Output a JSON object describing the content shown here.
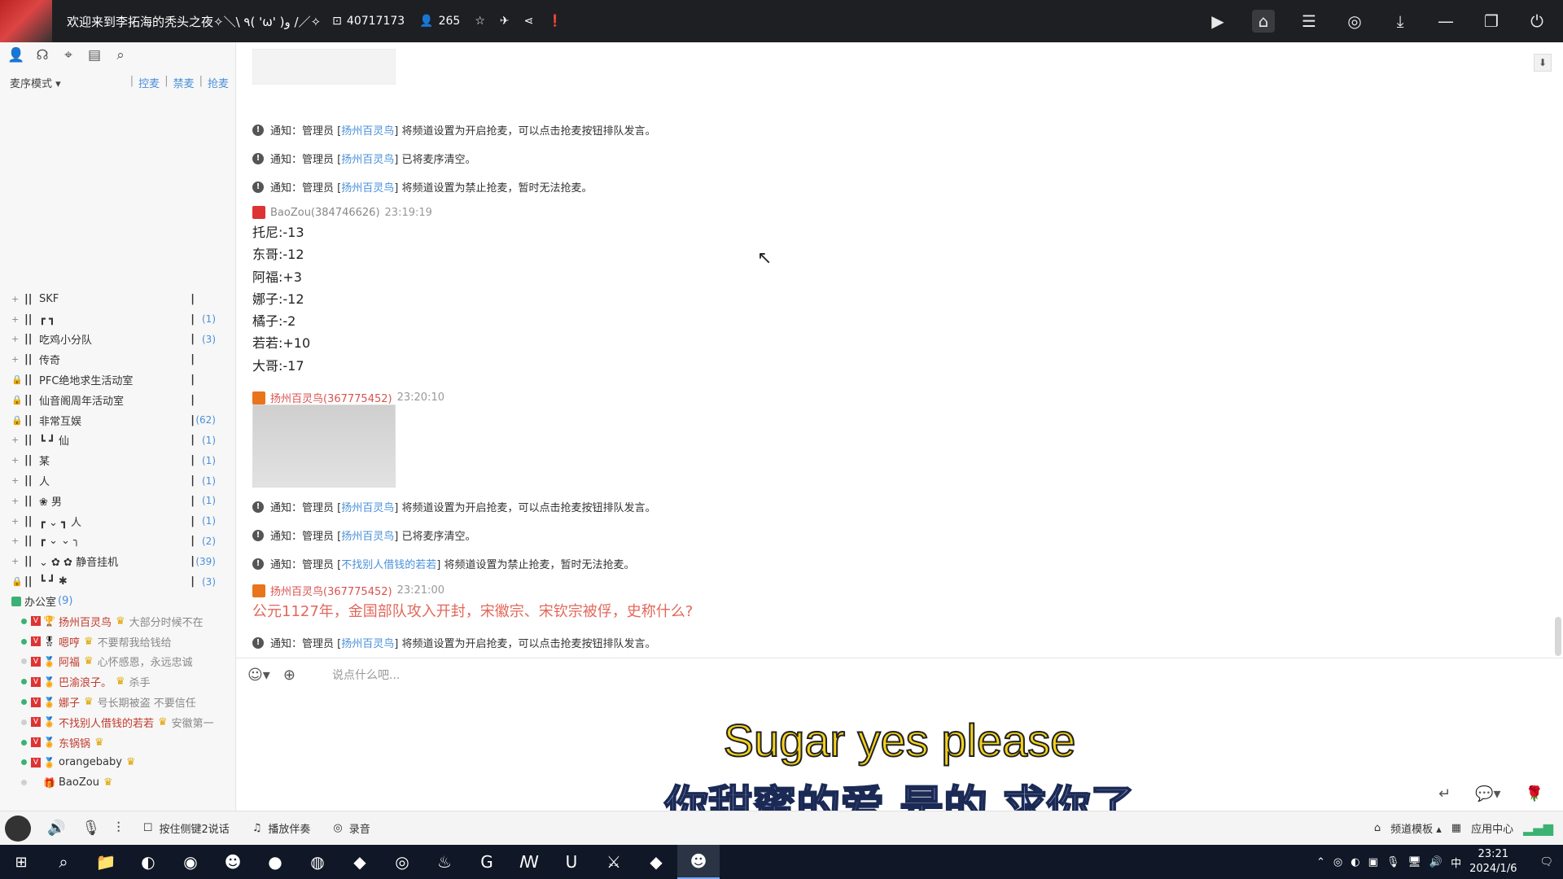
{
  "topbar": {
    "title": "欢迎来到李拓海的秃头之夜✧＼\\ ٩( 'ω' )و /／✧",
    "channel_id": "40717173",
    "online_count": "265",
    "icons": [
      "star-icon",
      "forward-icon",
      "share-icon",
      "info-icon"
    ],
    "right_icons": [
      "video-icon",
      "home-icon",
      "list-icon",
      "gamepad-icon",
      "download-icon",
      "minimize-icon",
      "restore-icon",
      "power-icon"
    ]
  },
  "left": {
    "toolbar_icons": [
      "user-icon",
      "headset-icon",
      "location-icon",
      "document-icon",
      "search-icon"
    ],
    "mic_mode": "麦序模式",
    "mic_links": [
      "控麦",
      "禁麦",
      "抢麦"
    ],
    "channels": [
      {
        "name": "SKF",
        "count": ""
      },
      {
        "name": "┏      ┓",
        "count": "(1)"
      },
      {
        "name": "吃鸡小分队",
        "count": "(3)"
      },
      {
        "name": "传奇",
        "count": ""
      },
      {
        "name": "PFC绝地求生活动室",
        "count": ""
      },
      {
        "name": "仙音阁周年活动室",
        "count": ""
      },
      {
        "name": "非常互娱",
        "count": "(62)"
      },
      {
        "name": "┗      ┛      仙",
        "count": "(1)"
      },
      {
        "name": "                  某",
        "count": "(1)"
      },
      {
        "name": "                  人",
        "count": "(1)"
      },
      {
        "name": "        ❀         男",
        "count": "(1)"
      },
      {
        "name": "   ┏ ⌄ ┓        人",
        "count": "(1)"
      },
      {
        "name": "┏ ⌄   ⌄ ╮",
        "count": "(2)"
      },
      {
        "name": "⌄ ✿  ✿  静音挂机",
        "count": "(39)"
      },
      {
        "name": "  ┗ ┛   ✱",
        "count": "(3)"
      }
    ],
    "office": {
      "name": "办公室",
      "count": "(9)"
    },
    "members": [
      {
        "name": "扬州百灵鸟",
        "sig": "大部分时候不在",
        "online": true
      },
      {
        "name": "嗯哼",
        "sig": "不要帮我给钱给",
        "online": true
      },
      {
        "name": "阿福",
        "sig": "心怀感恩，永远忠诚",
        "online": false
      },
      {
        "name": "巴渝浪子。",
        "sig": "杀手",
        "online": true
      },
      {
        "name": "娜子",
        "sig": "号长期被盗 不要信任",
        "online": true
      },
      {
        "name": "不找别人借钱的若若",
        "sig": "安徽第一",
        "online": false
      },
      {
        "name": "东锅锅",
        "sig": "",
        "online": true
      },
      {
        "name": "orangebaby",
        "sig": "",
        "online": true
      },
      {
        "name": "BaoZou",
        "sig": "",
        "online": false
      }
    ]
  },
  "chat": {
    "notices_top": [
      {
        "prefix": "通知：管理员 [",
        "who": "扬州百灵鸟",
        "text": "] 将频道设置为开启抢麦，可以点击抢麦按钮排队发言。"
      },
      {
        "prefix": "通知：管理员 [",
        "who": "扬州百灵鸟",
        "text": "] 已将麦序清空。"
      },
      {
        "prefix": "通知：管理员 [",
        "who": "扬州百灵鸟",
        "text": "] 将频道设置为禁止抢麦，暂时无法抢麦。"
      }
    ],
    "msg1": {
      "user": "BaoZou(384746626)",
      "time": "23:19:19",
      "lines": [
        "托尼:-13",
        "东哥:-12",
        "阿福:+3",
        "娜子:-12",
        "橘子:-2",
        "若若:+10",
        "大哥:-17"
      ]
    },
    "msg2": {
      "user": "扬州百灵鸟(367775452)",
      "time": "23:20:10"
    },
    "notices_mid": [
      {
        "prefix": "通知：管理员 [",
        "who": "扬州百灵鸟",
        "text": "] 将频道设置为开启抢麦，可以点击抢麦按钮排队发言。"
      },
      {
        "prefix": "通知：管理员 [",
        "who": "扬州百灵鸟",
        "text": "] 已将麦序清空。"
      },
      {
        "prefix": "通知：管理员 [",
        "who": "不找别人借钱的若若",
        "text": "] 将频道设置为禁止抢麦，暂时无法抢麦。"
      }
    ],
    "msg3": {
      "user": "扬州百灵鸟(367775452)",
      "time": "23:21:00",
      "text": "公元1127年，金国部队攻入开封，宋徽宗、宋钦宗被俘，史称什么?"
    },
    "notice_last": {
      "prefix": "通知：管理员 [",
      "who": "扬州百灵鸟",
      "text": "] 将频道设置为开启抢麦，可以点击抢麦按钮排队发言。"
    }
  },
  "input": {
    "placeholder": "说点什么吧...",
    "subtitle_en": "Sugar yes please",
    "subtitle_cn": "你甜蜜的爱 是的 求你了"
  },
  "bottombar": {
    "push_to_talk": "按住侧键2说话",
    "accompany": "播放伴奏",
    "record": "录音",
    "template": "频道模板",
    "app_center": "应用中心"
  },
  "taskbar": {
    "ime": "中",
    "time": "23:21",
    "date": "2024/1/6"
  }
}
